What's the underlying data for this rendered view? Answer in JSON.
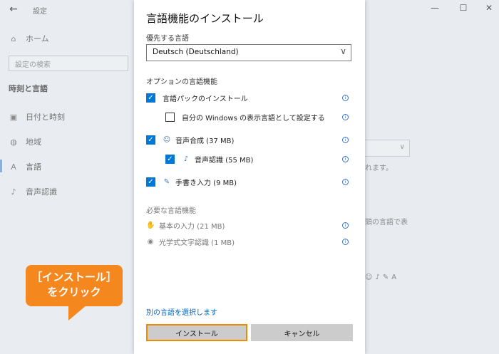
{
  "settings": {
    "title": "設定",
    "home": "ホーム",
    "search_placeholder": "設定の検索",
    "section": "時刻と言語",
    "nav": [
      "日付と時刻",
      "地域",
      "言語",
      "音声認識"
    ],
    "bg_text_1": "れます。",
    "bg_text_2": "頭の言語で表"
  },
  "dialog": {
    "title": "言語機能のインストール",
    "preferred_label": "優先する言語",
    "preferred_value": "Deutsch (Deutschland)",
    "optional_label": "オプションの言語機能",
    "options": [
      {
        "label": "言語パックのインストール",
        "checked": true
      },
      {
        "label": "自分の Windows の表示言語として設定する",
        "checked": false
      },
      {
        "label": "音声合成 (37 MB)",
        "checked": true
      },
      {
        "label": "音声認識 (55 MB)",
        "checked": true
      },
      {
        "label": "手書き入力 (9 MB)",
        "checked": true
      }
    ],
    "required_label": "必要な言語機能",
    "required": [
      "基本の入力 (21 MB)",
      "光学式文字認識 (1 MB)"
    ],
    "other_language_link": "別の言語を選択します",
    "install_button": "インストール",
    "cancel_button": "キャンセル"
  },
  "callout": {
    "line1": "［インストール］",
    "line2": "をクリック",
    "color": "#f5871f"
  },
  "colors": {
    "accent": "#0078d7",
    "highlight": "#f08a00"
  }
}
